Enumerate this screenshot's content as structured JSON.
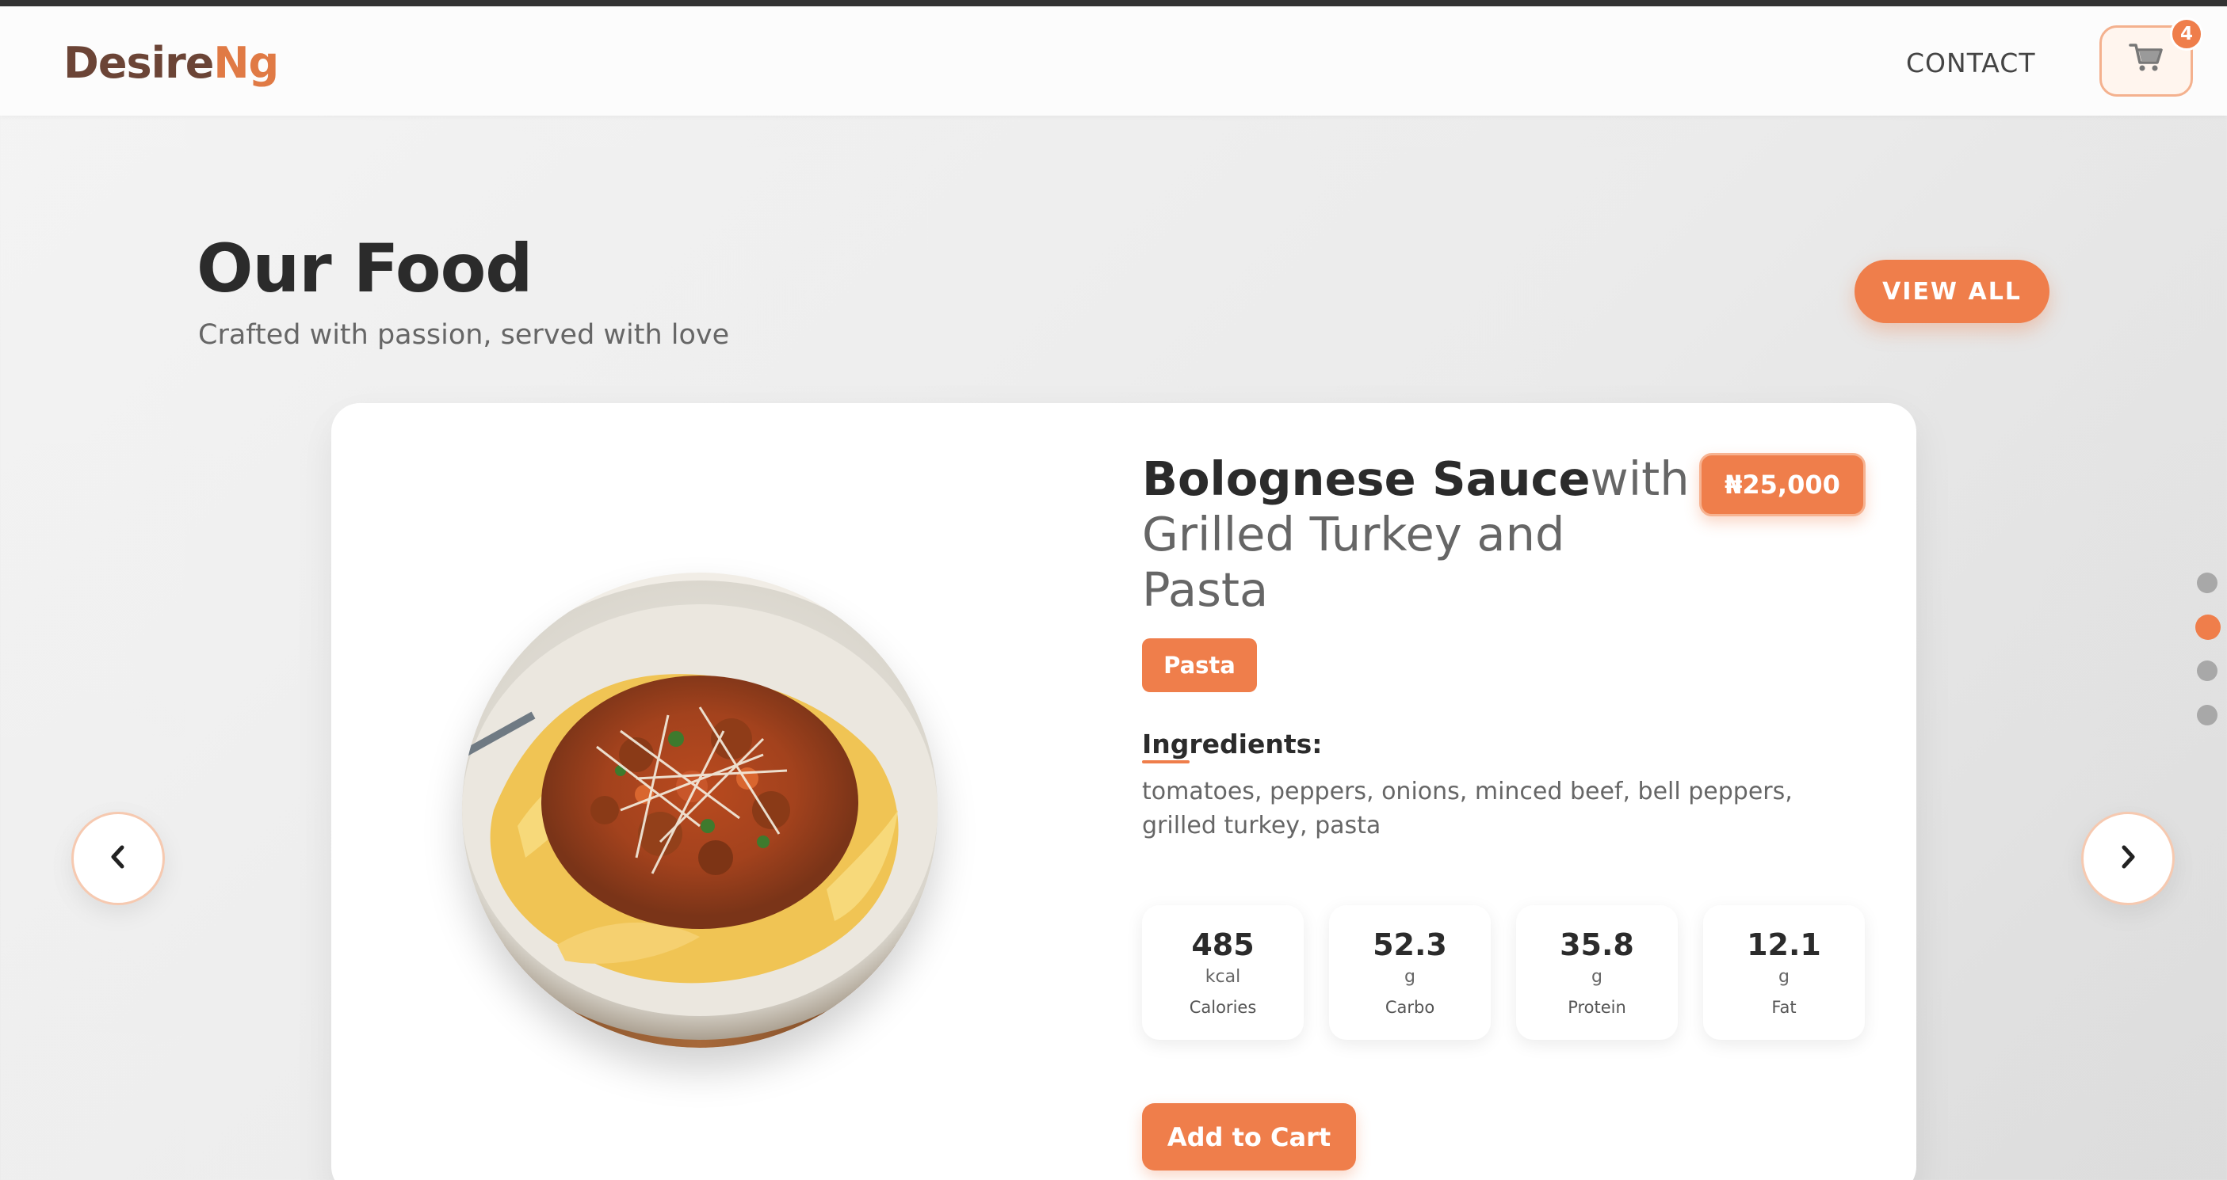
{
  "nav": {
    "logo_part1": "Desire",
    "logo_part2": "Ng",
    "contact_label": "CONTACT",
    "cart_icon": "cart-icon",
    "cart_count": "4"
  },
  "section": {
    "title": "Our Food",
    "subtitle": "Crafted with passion, served with love",
    "view_all_label": "VIEW ALL"
  },
  "food": {
    "name_bold": "Bolognese Sauce",
    "name_rest": "with Grilled Turkey and Pasta",
    "price": "₦25,000",
    "category": "Pasta",
    "ingredients_label": "Ingredients:",
    "ingredients": "tomatoes, peppers, onions, minced beef, bell peppers, grilled turkey, pasta",
    "nutrition": [
      {
        "value": "485",
        "unit": "kcal",
        "label": "Calories"
      },
      {
        "value": "52.3",
        "unit": "g",
        "label": "Carbo"
      },
      {
        "value": "35.8",
        "unit": "g",
        "label": "Protein"
      },
      {
        "value": "12.1",
        "unit": "g",
        "label": "Fat"
      }
    ],
    "add_to_cart_label": "Add to Cart"
  },
  "carousel": {
    "prev_icon": "chevron-left-icon",
    "next_icon": "chevron-right-icon",
    "slide_count": 4,
    "active_slide": 2
  },
  "colors": {
    "accent": "#ef7e4b",
    "logo_dark": "#6b4436",
    "text_dark": "#2b2b2b"
  }
}
